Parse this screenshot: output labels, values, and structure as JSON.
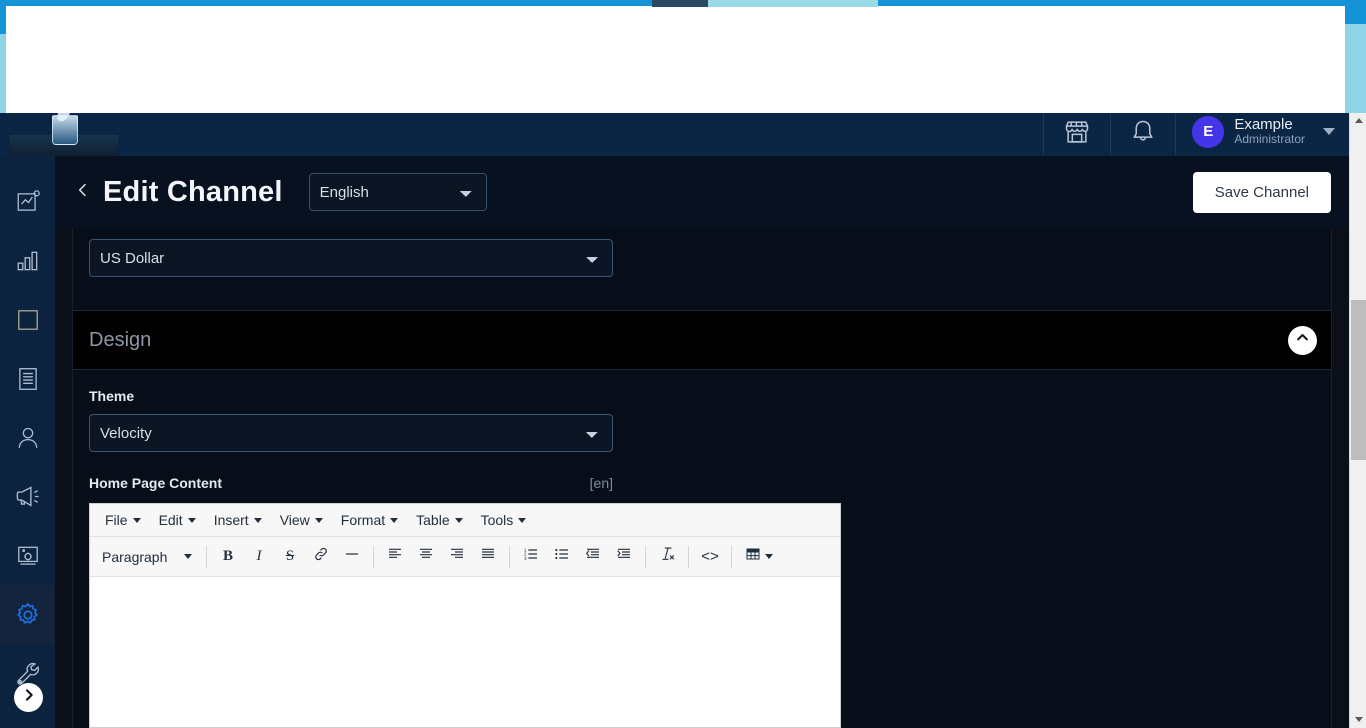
{
  "topnav": {
    "logo_alt": "channel-logo",
    "icons": [
      {
        "name": "storefront-icon",
        "label": "Store"
      },
      {
        "name": "bell-icon",
        "label": "Notifications"
      }
    ],
    "user": {
      "initial": "E",
      "name": "Example",
      "role": "Administrator"
    }
  },
  "sidebar": {
    "items": [
      {
        "name": "sidebar-item-dashboard",
        "icon": "chart-window-icon",
        "active": false
      },
      {
        "name": "sidebar-item-reports",
        "icon": "bar-chart-icon",
        "active": false
      },
      {
        "name": "sidebar-item-products",
        "icon": "square-icon",
        "active": false
      },
      {
        "name": "sidebar-item-orders",
        "icon": "document-lines-icon",
        "active": false
      },
      {
        "name": "sidebar-item-customers",
        "icon": "person-icon",
        "active": false
      },
      {
        "name": "sidebar-item-marketing",
        "icon": "megaphone-icon",
        "active": false
      },
      {
        "name": "sidebar-item-content",
        "icon": "image-gear-icon",
        "active": false
      },
      {
        "name": "sidebar-item-settings",
        "icon": "gear-icon",
        "active": true
      },
      {
        "name": "sidebar-item-tools",
        "icon": "wrench-icon",
        "active": false
      }
    ],
    "expand_button": "chevron-right-icon"
  },
  "page_header": {
    "back_icon": "chevron-left-icon",
    "title": "Edit Channel",
    "language": {
      "selected": "English",
      "options": [
        "English"
      ]
    },
    "save_button": "Save Channel"
  },
  "content": {
    "currency": {
      "selected": "US Dollar",
      "options": [
        "US Dollar"
      ]
    },
    "design_section": {
      "title": "Design",
      "collapse_icon": "chevron-up-icon"
    },
    "theme": {
      "label": "Theme",
      "selected": "Velocity",
      "options": [
        "Velocity"
      ]
    },
    "home_page_content": {
      "label": "Home Page Content",
      "language_tag": "[en]"
    }
  },
  "editor": {
    "menubar": [
      "File",
      "Edit",
      "Insert",
      "View",
      "Format",
      "Table",
      "Tools"
    ],
    "format_select": "Paragraph",
    "toolbar": [
      {
        "name": "bold-icon",
        "label": "B"
      },
      {
        "name": "italic-icon",
        "label": "I"
      },
      {
        "name": "strikethrough-icon",
        "label": "S"
      },
      {
        "name": "link-icon",
        "label": "ὑ7"
      },
      {
        "name": "horizontal-rule-icon",
        "label": "—"
      },
      {
        "name": "align-left-icon",
        "label": ""
      },
      {
        "name": "align-center-icon",
        "label": ""
      },
      {
        "name": "align-right-icon",
        "label": ""
      },
      {
        "name": "align-justify-icon",
        "label": ""
      },
      {
        "name": "numbered-list-icon",
        "label": ""
      },
      {
        "name": "bullet-list-icon",
        "label": ""
      },
      {
        "name": "decrease-indent-icon",
        "label": ""
      },
      {
        "name": "increase-indent-icon",
        "label": ""
      },
      {
        "name": "clear-formatting-icon",
        "label": ""
      },
      {
        "name": "source-code-icon",
        "label": "<>"
      },
      {
        "name": "table-icon",
        "label": ""
      }
    ],
    "body_text": ""
  },
  "colors": {
    "accent_blue": "#1494d6",
    "nav_navy": "#0b2545",
    "sidebar_navy": "#0c233f",
    "panel_dark": "#080e19",
    "avatar_purple": "#4436e8",
    "active_icon_blue": "#1f6fe0"
  }
}
